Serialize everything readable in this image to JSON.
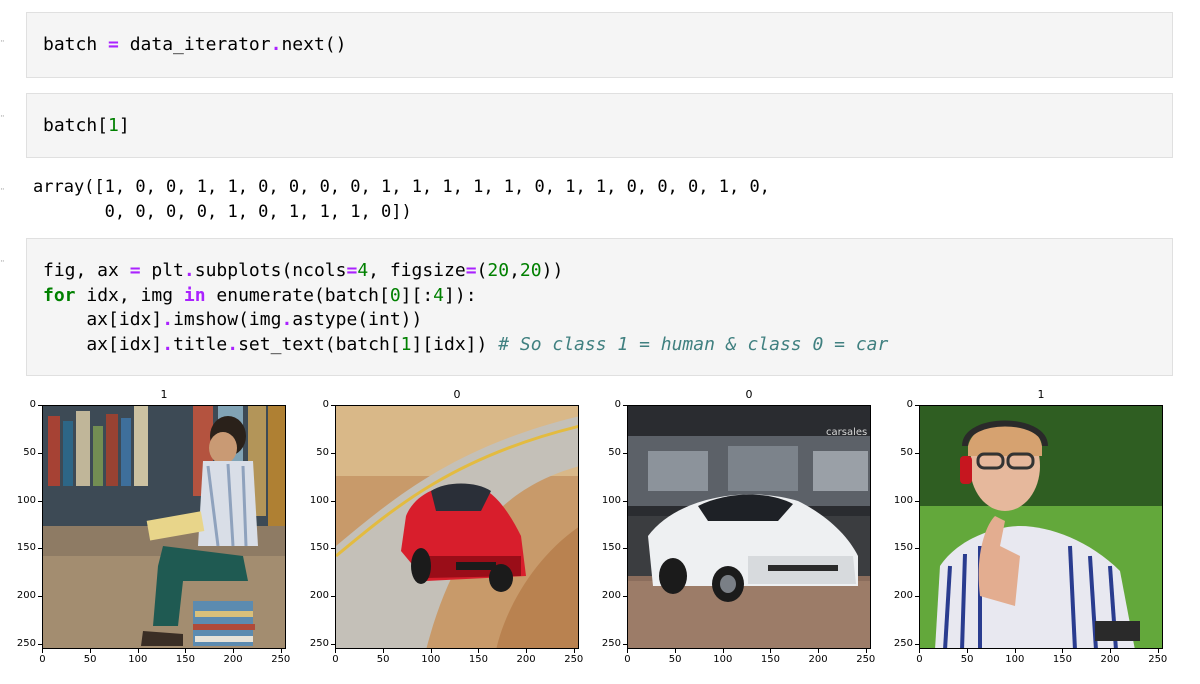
{
  "cells": [
    {
      "lines": [
        [
          {
            "t": "batch "
          },
          {
            "t": "=",
            "c": "op"
          },
          {
            "t": " data_iterator"
          },
          {
            "t": ".",
            "c": "op"
          },
          {
            "t": "next()"
          }
        ]
      ]
    },
    {
      "lines": [
        [
          {
            "t": "batch["
          },
          {
            "t": "1",
            "c": "num"
          },
          {
            "t": "]"
          }
        ]
      ]
    },
    {
      "lines": [
        [
          {
            "t": "fig, ax "
          },
          {
            "t": "=",
            "c": "op"
          },
          {
            "t": " plt"
          },
          {
            "t": ".",
            "c": "op"
          },
          {
            "t": "subplots(ncols"
          },
          {
            "t": "=",
            "c": "op"
          },
          {
            "t": "4",
            "c": "num"
          },
          {
            "t": ", figsize"
          },
          {
            "t": "=",
            "c": "op"
          },
          {
            "t": "("
          },
          {
            "t": "20",
            "c": "num"
          },
          {
            "t": ","
          },
          {
            "t": "20",
            "c": "num"
          },
          {
            "t": "))"
          }
        ],
        [
          {
            "t": "for",
            "c": "kw"
          },
          {
            "t": " idx, img "
          },
          {
            "t": "in",
            "c": "op"
          },
          {
            "t": " enumerate(batch["
          },
          {
            "t": "0",
            "c": "num"
          },
          {
            "t": "][:"
          },
          {
            "t": "4",
            "c": "num"
          },
          {
            "t": "]):"
          }
        ],
        [
          {
            "t": "    ax[idx]"
          },
          {
            "t": ".",
            "c": "op"
          },
          {
            "t": "imshow(img"
          },
          {
            "t": ".",
            "c": "op"
          },
          {
            "t": "astype(int))"
          }
        ],
        [
          {
            "t": "    ax[idx]"
          },
          {
            "t": ".",
            "c": "op"
          },
          {
            "t": "title"
          },
          {
            "t": ".",
            "c": "op"
          },
          {
            "t": "set_text(batch["
          },
          {
            "t": "1",
            "c": "num"
          },
          {
            "t": "][idx]) "
          },
          {
            "t": "# So class 1 = human & class 0 = car",
            "c": "cm"
          }
        ]
      ]
    }
  ],
  "output": {
    "line1": "array([1, 0, 0, 1, 1, 0, 0, 0, 0, 1, 1, 1, 1, 1, 0, 1, 1, 0, 0, 0, 1, 0,",
    "line2": "       0, 0, 0, 0, 1, 0, 1, 1, 1, 0])"
  },
  "plots": [
    {
      "title": "1",
      "subject": "child reading book in library"
    },
    {
      "title": "0",
      "subject": "red sports car on road"
    },
    {
      "title": "0",
      "subject": "white supercar in showroom",
      "watermark": "carsales"
    },
    {
      "title": "1",
      "subject": "boy with headphones giving thumbs up"
    }
  ],
  "axis": {
    "yticks": [
      "0",
      "50",
      "100",
      "150",
      "200",
      "250"
    ],
    "xticks": [
      "0",
      "50",
      "100",
      "150",
      "200",
      "250"
    ]
  }
}
